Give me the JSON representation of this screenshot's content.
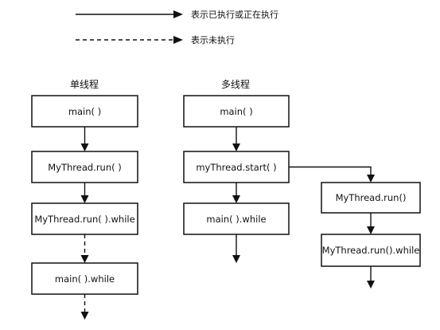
{
  "legend": {
    "solid_label": "表示已执行或正在执行",
    "dashed_label": "表示未执行"
  },
  "single_thread": {
    "title": "单线程",
    "boxes": [
      "main( )",
      "MyThread.run( )",
      "MyThread.run( ).while",
      "main( ).while"
    ]
  },
  "multi_thread": {
    "title": "多线程",
    "boxes": [
      "main( )",
      "myThread.start( )",
      "main( ).while"
    ],
    "branch_boxes": [
      "MyThread.run()",
      "MyThread.run().while"
    ]
  }
}
